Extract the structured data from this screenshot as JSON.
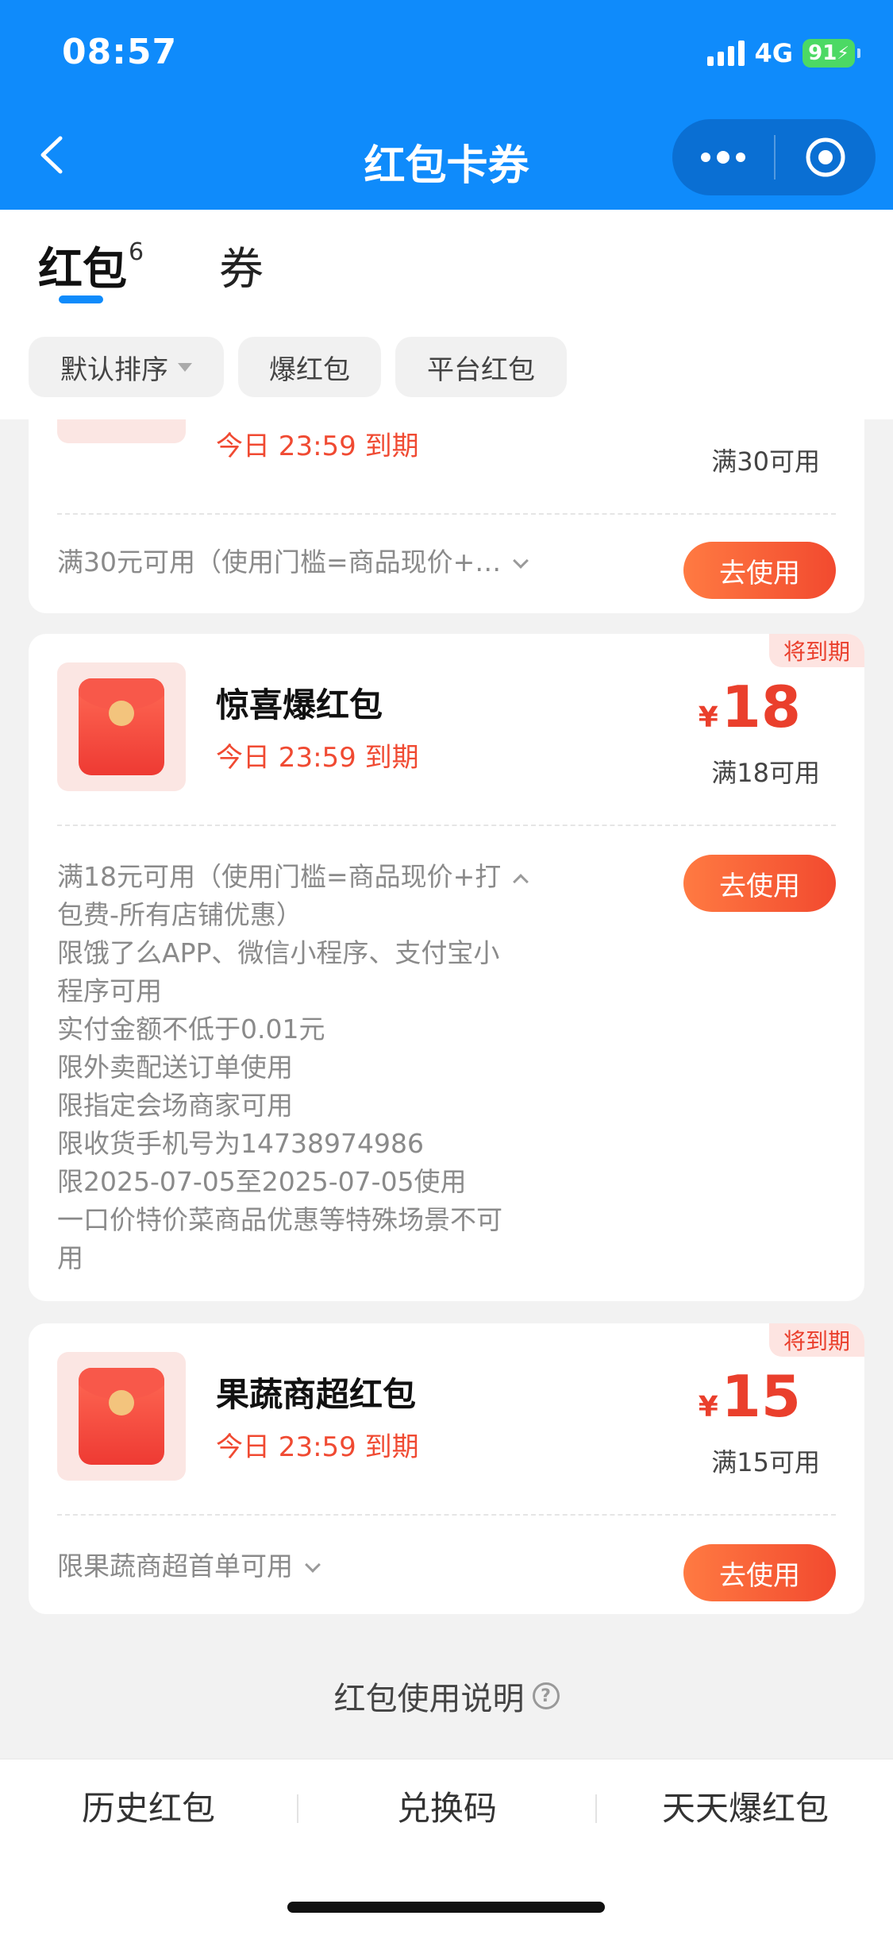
{
  "status_bar": {
    "time": "08:57",
    "network": "4G",
    "battery": "91"
  },
  "header": {
    "title": "红包卡券",
    "back_icon": "chevron-left-icon",
    "more_icon": "more-dots-icon",
    "close_icon": "target-circle-icon"
  },
  "tabs": [
    {
      "label": "红包",
      "count": "6",
      "active": true
    },
    {
      "label": "券",
      "active": false
    }
  ],
  "filters": [
    {
      "label": "默认排序"
    },
    {
      "label": "爆红包"
    },
    {
      "label": "平台红包"
    }
  ],
  "cards": [
    {
      "expire": "今日 23:59 到期",
      "threshold": "满30可用",
      "desc": "满30元可用（使用门槛=商品现价+…",
      "button": "去使用"
    },
    {
      "badge": "将到期",
      "name": "惊喜爆红包",
      "expire": "今日 23:59 到期",
      "currency": "¥",
      "amount": "18",
      "threshold": "满18可用",
      "desc_lines": [
        "满18元可用（使用门槛=商品现价+打",
        "包费-所有店铺优惠）",
        "限饿了么APP、微信小程序、支付宝小",
        "程序可用",
        "实付金额不低于0.01元",
        "限外卖配送订单使用",
        "限指定会场商家可用",
        "限收货手机号为14738974986",
        "限2025-07-05至2025-07-05使用",
        "一口价特价菜商品优惠等特殊场景不可",
        "用"
      ],
      "button": "去使用"
    },
    {
      "badge": "将到期",
      "name": "果蔬商超红包",
      "expire": "今日 23:59 到期",
      "currency": "¥",
      "amount": "15",
      "threshold": "满15可用",
      "desc": "限果蔬商超首单可用",
      "button": "去使用"
    }
  ],
  "help": {
    "label": "红包使用说明",
    "icon": "question-circle-icon",
    "icon_glyph": "?"
  },
  "bottom_bar": [
    {
      "label": "历史红包"
    },
    {
      "label": "兑换码"
    },
    {
      "label": "天天爆红包"
    }
  ],
  "colors": {
    "header_blue": "#0f8bfb",
    "accent_red": "#ea3f2c",
    "button_orange": "#f24a2f"
  }
}
